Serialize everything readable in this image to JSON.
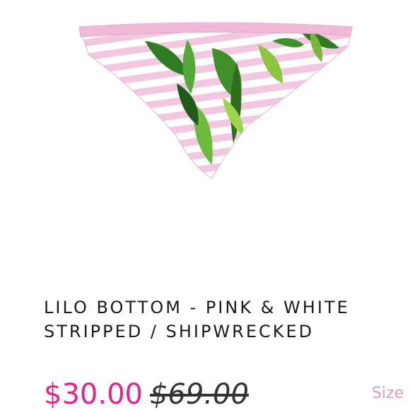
{
  "product": {
    "title_line1": "LILO BOTTOM - PINK & WHITE",
    "title_line2": "STRIPPED / SHIPWRECKED",
    "sale_price": "$30.00",
    "original_price": "$69.00",
    "size_label": "Size"
  },
  "colors": {
    "sale_price": "#e5218a",
    "size_label": "#d79ac2",
    "stripe_pink": "#f3c7e0",
    "leaf_green": "#3f8f2a"
  }
}
